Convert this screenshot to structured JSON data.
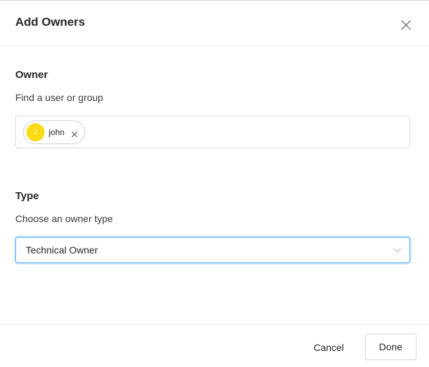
{
  "modal": {
    "title": "Add Owners",
    "close_icon": "close-icon"
  },
  "owner": {
    "label": "Owner",
    "sublabel": "Find a user or group",
    "selected": [
      {
        "avatar_initial": "J",
        "name": "john",
        "avatar_color": "#fadb14"
      }
    ]
  },
  "type": {
    "label": "Type",
    "sublabel": "Choose an owner type",
    "selected_value": "Technical Owner",
    "chevron_icon": "chevron-down-icon"
  },
  "footer": {
    "cancel_label": "Cancel",
    "done_label": "Done"
  },
  "colors": {
    "focus_border": "#40a9ff",
    "avatar": "#fadb14"
  }
}
